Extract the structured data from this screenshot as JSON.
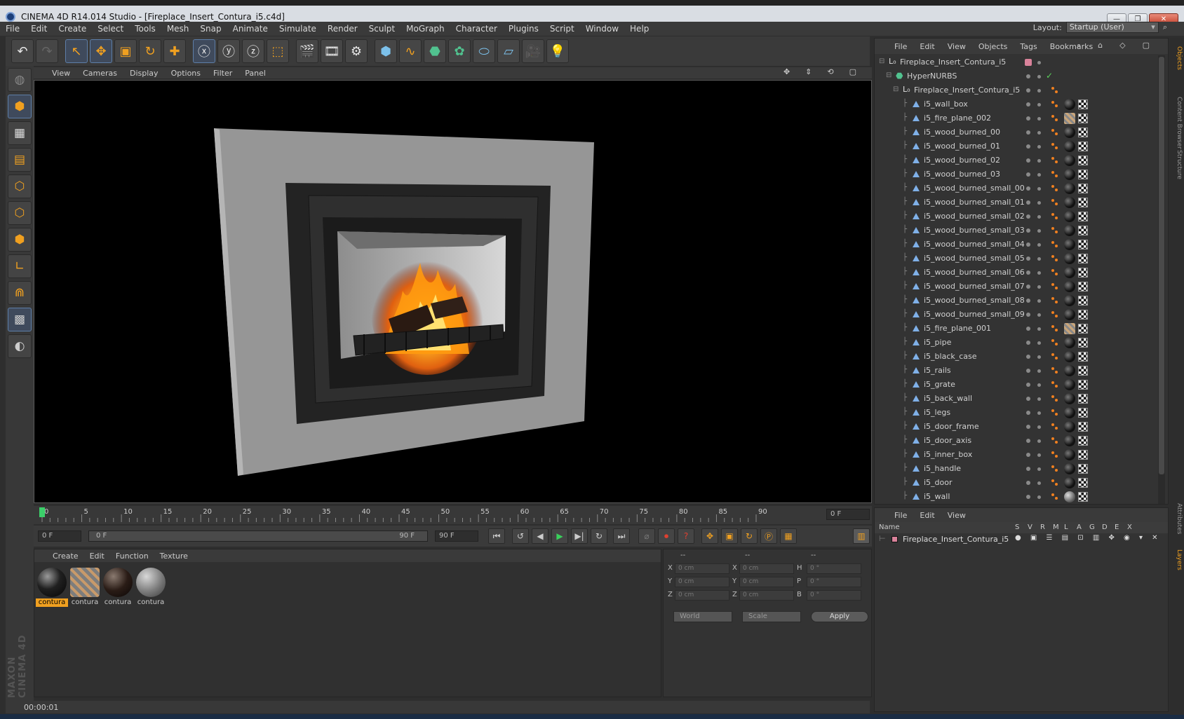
{
  "window": {
    "title": "CINEMA 4D R14.014 Studio - [Fireplace_Insert_Contura_i5.c4d]"
  },
  "menu": [
    "File",
    "Edit",
    "Create",
    "Select",
    "Tools",
    "Mesh",
    "Snap",
    "Animate",
    "Simulate",
    "Render",
    "Sculpt",
    "MoGraph",
    "Character",
    "Plugins",
    "Script",
    "Window",
    "Help"
  ],
  "layout": {
    "label": "Layout:",
    "value": "Startup (User)"
  },
  "viewport_menu": [
    "View",
    "Cameras",
    "Display",
    "Options",
    "Filter",
    "Panel"
  ],
  "timeline": {
    "ticks": [
      "0",
      "5",
      "10",
      "15",
      "20",
      "25",
      "30",
      "35",
      "40",
      "45",
      "50",
      "55",
      "60",
      "65",
      "70",
      "75",
      "80",
      "85",
      "90"
    ],
    "current_frame": "0 F",
    "start_frame": "0 F",
    "range_start": "0 F",
    "range_end": "90 F",
    "end_frame": "90 F"
  },
  "material_menu": [
    "Create",
    "Edit",
    "Function",
    "Texture"
  ],
  "materials": [
    {
      "name": "contura",
      "style": "black-glossy",
      "selected": true
    },
    {
      "name": "contura",
      "style": "fire-stripe",
      "selected": false
    },
    {
      "name": "contura",
      "style": "dark-wood",
      "selected": false
    },
    {
      "name": "contura",
      "style": "gray",
      "selected": false
    }
  ],
  "coords": {
    "headers": [
      "--",
      "--",
      "--"
    ],
    "rows": [
      {
        "l1": "X",
        "v1": "0 cm",
        "l2": "X",
        "v2": "0 cm",
        "l3": "H",
        "v3": "0 °"
      },
      {
        "l1": "Y",
        "v1": "0 cm",
        "l2": "Y",
        "v2": "0 cm",
        "l3": "P",
        "v3": "0 °"
      },
      {
        "l1": "Z",
        "v1": "0 cm",
        "l2": "Z",
        "v2": "0 cm",
        "l3": "B",
        "v3": "0 °"
      }
    ],
    "world": "World",
    "scale": "Scale",
    "apply": "Apply"
  },
  "status": "00:00:01",
  "object_menu": [
    "File",
    "Edit",
    "View",
    "Objects",
    "Tags",
    "Bookmarks"
  ],
  "objects": [
    {
      "name": "Fireplace_Insert_Contura_i5",
      "level": 0,
      "kind": "null",
      "tags": "none"
    },
    {
      "name": "HyperNURBS",
      "level": 1,
      "kind": "nurbs",
      "tags": "none"
    },
    {
      "name": "Fireplace_Insert_Contura_i5",
      "level": 2,
      "kind": "null",
      "tags": "none"
    },
    {
      "name": "i5_wall_box",
      "level": 3,
      "kind": "poly",
      "tags": "ball"
    },
    {
      "name": "i5_fire_plane_002",
      "level": 3,
      "kind": "poly",
      "tags": "stripe"
    },
    {
      "name": "i5_wood_burned_00",
      "level": 3,
      "kind": "poly",
      "tags": "ball"
    },
    {
      "name": "i5_wood_burned_01",
      "level": 3,
      "kind": "poly",
      "tags": "ball"
    },
    {
      "name": "i5_wood_burned_02",
      "level": 3,
      "kind": "poly",
      "tags": "ball"
    },
    {
      "name": "i5_wood_burned_03",
      "level": 3,
      "kind": "poly",
      "tags": "ball"
    },
    {
      "name": "i5_wood_burned_small_00",
      "level": 3,
      "kind": "poly",
      "tags": "ball"
    },
    {
      "name": "i5_wood_burned_small_01",
      "level": 3,
      "kind": "poly",
      "tags": "ball"
    },
    {
      "name": "i5_wood_burned_small_02",
      "level": 3,
      "kind": "poly",
      "tags": "ball"
    },
    {
      "name": "i5_wood_burned_small_03",
      "level": 3,
      "kind": "poly",
      "tags": "ball"
    },
    {
      "name": "i5_wood_burned_small_04",
      "level": 3,
      "kind": "poly",
      "tags": "ball"
    },
    {
      "name": "i5_wood_burned_small_05",
      "level": 3,
      "kind": "poly",
      "tags": "ball"
    },
    {
      "name": "i5_wood_burned_small_06",
      "level": 3,
      "kind": "poly",
      "tags": "ball"
    },
    {
      "name": "i5_wood_burned_small_07",
      "level": 3,
      "kind": "poly",
      "tags": "ball"
    },
    {
      "name": "i5_wood_burned_small_08",
      "level": 3,
      "kind": "poly",
      "tags": "ball"
    },
    {
      "name": "i5_wood_burned_small_09",
      "level": 3,
      "kind": "poly",
      "tags": "ball"
    },
    {
      "name": "i5_fire_plane_001",
      "level": 3,
      "kind": "poly",
      "tags": "stripe"
    },
    {
      "name": "i5_pipe",
      "level": 3,
      "kind": "poly",
      "tags": "ball"
    },
    {
      "name": "i5_black_case",
      "level": 3,
      "kind": "poly",
      "tags": "ball"
    },
    {
      "name": "i5_rails",
      "level": 3,
      "kind": "poly",
      "tags": "ball"
    },
    {
      "name": "i5_grate",
      "level": 3,
      "kind": "poly",
      "tags": "ball"
    },
    {
      "name": "i5_back_wall",
      "level": 3,
      "kind": "poly",
      "tags": "ball"
    },
    {
      "name": "i5_legs",
      "level": 3,
      "kind": "poly",
      "tags": "ball"
    },
    {
      "name": "i5_door_frame",
      "level": 3,
      "kind": "poly",
      "tags": "ball"
    },
    {
      "name": "i5_door_axis",
      "level": 3,
      "kind": "poly",
      "tags": "ball"
    },
    {
      "name": "i5_inner_box",
      "level": 3,
      "kind": "poly",
      "tags": "ball"
    },
    {
      "name": "i5_handle",
      "level": 3,
      "kind": "poly",
      "tags": "ball"
    },
    {
      "name": "i5_door",
      "level": 3,
      "kind": "poly",
      "tags": "ball"
    },
    {
      "name": "i5_wall",
      "level": 3,
      "kind": "poly",
      "tags": "gray"
    }
  ],
  "side_tabs": [
    "Objects",
    "Content Browser",
    "Structure",
    "Attributes",
    "Layers"
  ],
  "layer_menu": [
    "File",
    "Edit",
    "View"
  ],
  "layer_headers": [
    "Name",
    "S",
    "V",
    "R",
    "M",
    "L",
    "A",
    "G",
    "D",
    "E",
    "X"
  ],
  "layers": [
    {
      "name": "Fireplace_Insert_Contura_i5"
    }
  ],
  "colors": {
    "accent": "#f0a020",
    "bg": "#333333",
    "layer_swatch": "#d9829a"
  }
}
